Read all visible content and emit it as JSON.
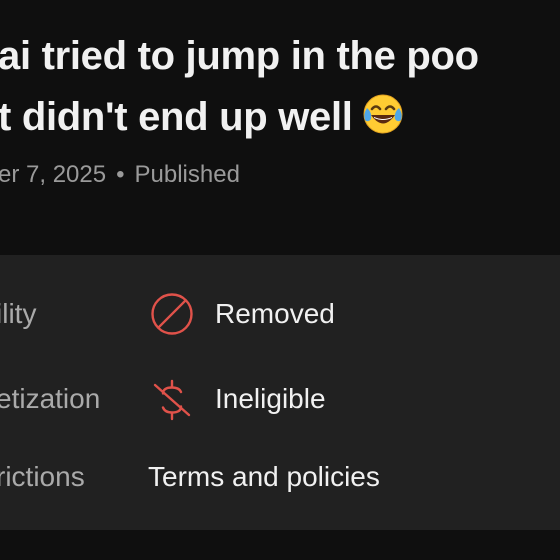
{
  "video": {
    "title_line1": "ai tried to jump in the poo",
    "title_line2": "t didn't end up well",
    "title_emoji": "face-with-tears-of-joy",
    "date": "er 7, 2025",
    "separator": "•",
    "status": "Published"
  },
  "details": {
    "visibility": {
      "label": "ility",
      "icon": "prohibited-icon",
      "value": "Removed"
    },
    "monetization": {
      "label": "etization",
      "icon": "no-money-icon",
      "value": "Ineligible"
    },
    "restrictions": {
      "label": "rictions",
      "value": "Terms and policies"
    }
  },
  "colors": {
    "background": "#0f0f0f",
    "panel": "#212121",
    "title": "#f1f1f1",
    "muted": "#aaaaaa",
    "alert_red": "#e0524a"
  }
}
